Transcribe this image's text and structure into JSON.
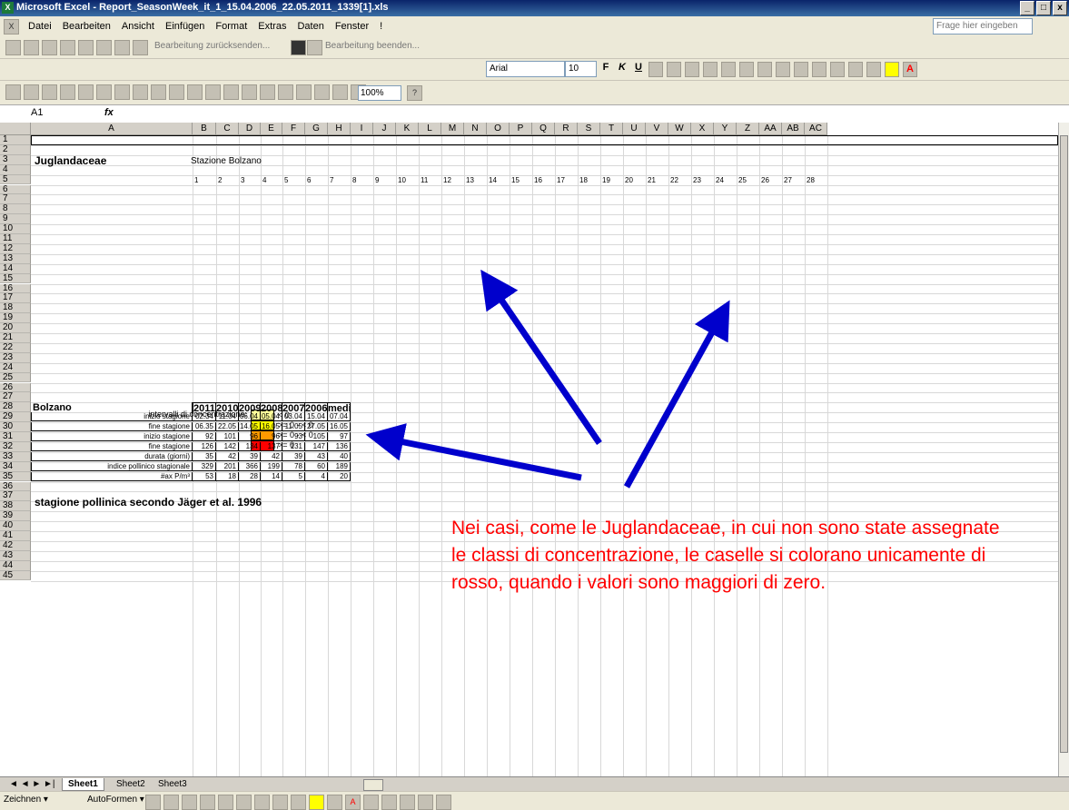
{
  "window": {
    "title": "Microsoft Excel - Report_SeasonWeek_it_1_15.04.2006_22.05.2011_1339[1].xls",
    "min": "_",
    "max": "□",
    "close": "x"
  },
  "menu": {
    "items": [
      "Datei",
      "Bearbeiten",
      "Ansicht",
      "Einfügen",
      "Format",
      "Extras",
      "Daten",
      "Fenster",
      "!"
    ],
    "ask_placeholder": "Frage hier eingeben"
  },
  "toolbar": {
    "review_back": "Bearbeitung zurücksenden...",
    "review_end": "Bearbeitung beenden...",
    "font": "Arial",
    "size": "10",
    "bold": "F",
    "italic": "K",
    "underline": "U",
    "zoom": "100%"
  },
  "formula": {
    "cell": "A1",
    "fx": "fx"
  },
  "columns": [
    "A",
    "B",
    "C",
    "D",
    "E",
    "F",
    "G",
    "H",
    "I",
    "J",
    "K",
    "L",
    "M",
    "N",
    "O",
    "P",
    "Q",
    "R",
    "S",
    "T",
    "U",
    "V",
    "W",
    "X",
    "Y",
    "Z",
    "AA",
    "AB",
    "AC"
  ],
  "rows": [
    "1",
    "2",
    "3",
    "4",
    "5",
    "6",
    "7",
    "8",
    "9",
    "10",
    "11",
    "12",
    "13",
    "14",
    "15",
    "16",
    "17",
    "18",
    "19",
    "20",
    "21",
    "22",
    "23",
    "24",
    "25",
    "26",
    "27",
    "28",
    "29",
    "30",
    "31",
    "32",
    "33",
    "34",
    "35",
    "36",
    "37",
    "38",
    "39",
    "40",
    "41",
    "42",
    "43",
    "44",
    "45"
  ],
  "sheet": {
    "family": "Juglandaceae",
    "station": "Stazione Bolzano",
    "week_headers": [
      "1",
      "2",
      "3",
      "4",
      "5",
      "6",
      "7",
      "8",
      "9",
      "10",
      "11",
      "12",
      "13",
      "14",
      "15",
      "16",
      "17",
      "18",
      "19",
      "20",
      "21",
      "22",
      "23",
      "24",
      "25",
      "26",
      "27",
      "28"
    ],
    "legend": {
      "label": "intervalli di concentrazione:",
      "items": [
        "< 0",
        ">= 0 - < 0",
        ">= 0 - < 0",
        ">= 0"
      ]
    },
    "season_title": "stagione pollinica secondo Jäger et al. 1996",
    "table": {
      "header": [
        "Bolzano",
        "2011",
        "2010",
        "2009",
        "2008",
        "2007",
        "2006",
        "media"
      ],
      "rows": [
        [
          "inizio stagione",
          "02.34",
          "11.04",
          "06.04",
          "05.04",
          "03.04",
          "15.04",
          "07.04"
        ],
        [
          "fine stagione",
          "06.35",
          "22.05",
          "14.05",
          "16.05",
          "11.05",
          "27.05",
          "16.05"
        ],
        [
          "inizio stagione",
          "92",
          "101",
          "96",
          "96",
          "93",
          "105",
          "97"
        ],
        [
          "fine stagione",
          "126",
          "142",
          "134",
          "137",
          "131",
          "147",
          "136"
        ],
        [
          "durata (giorni)",
          "35",
          "42",
          "39",
          "42",
          "39",
          "43",
          "40"
        ],
        [
          "indice pollinico stagionale",
          "329",
          "201",
          "366",
          "199",
          "78",
          "60",
          "189"
        ],
        [
          "#ax P/m³",
          "53",
          "18",
          "28",
          "14",
          "5",
          "4",
          "20"
        ]
      ]
    }
  },
  "annotation": "Nei casi, come le Juglandaceae, in cui non sono state assegnate le classi di concentrazione, le caselle si colorano unicamente di rosso, quando i valori sono maggiori di zero.",
  "tabs": {
    "nav": "◄ ◄ ► ►|",
    "sheets": [
      "Sheet1",
      "Sheet2",
      "Sheet3"
    ]
  },
  "drawbar": {
    "draw": "Zeichnen ▾",
    "autoshapes": "AutoFormen ▾"
  },
  "colors": {
    "red": "#ff0000",
    "legend_light_yellow": "#ffff99",
    "legend_yellow": "#ffff00",
    "legend_orange": "#ff9900",
    "legend_red": "#ff0000",
    "annotation": "#ff0000",
    "arrow": "#0000cc"
  }
}
